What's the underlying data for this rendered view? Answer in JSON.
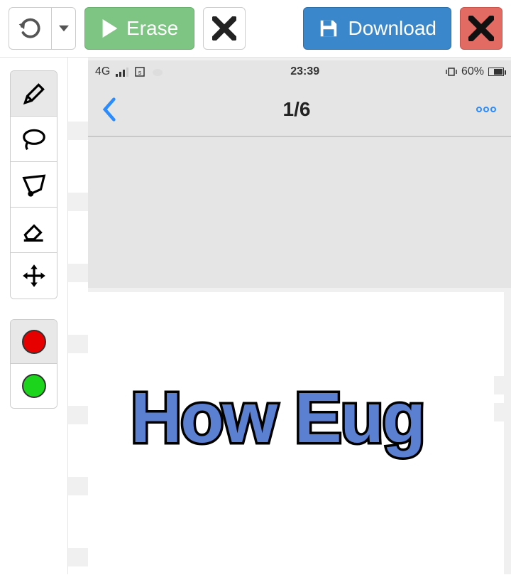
{
  "toolbar": {
    "erase_label": "Erase",
    "download_label": "Download"
  },
  "swatches": {
    "red": "#e60000",
    "green": "#1bd41b"
  },
  "phone": {
    "status": {
      "signal": "4G",
      "time": "23:39",
      "battery_pct": "60%"
    },
    "nav": {
      "title": "1/6"
    }
  },
  "content": {
    "big_text": "How Eug"
  }
}
